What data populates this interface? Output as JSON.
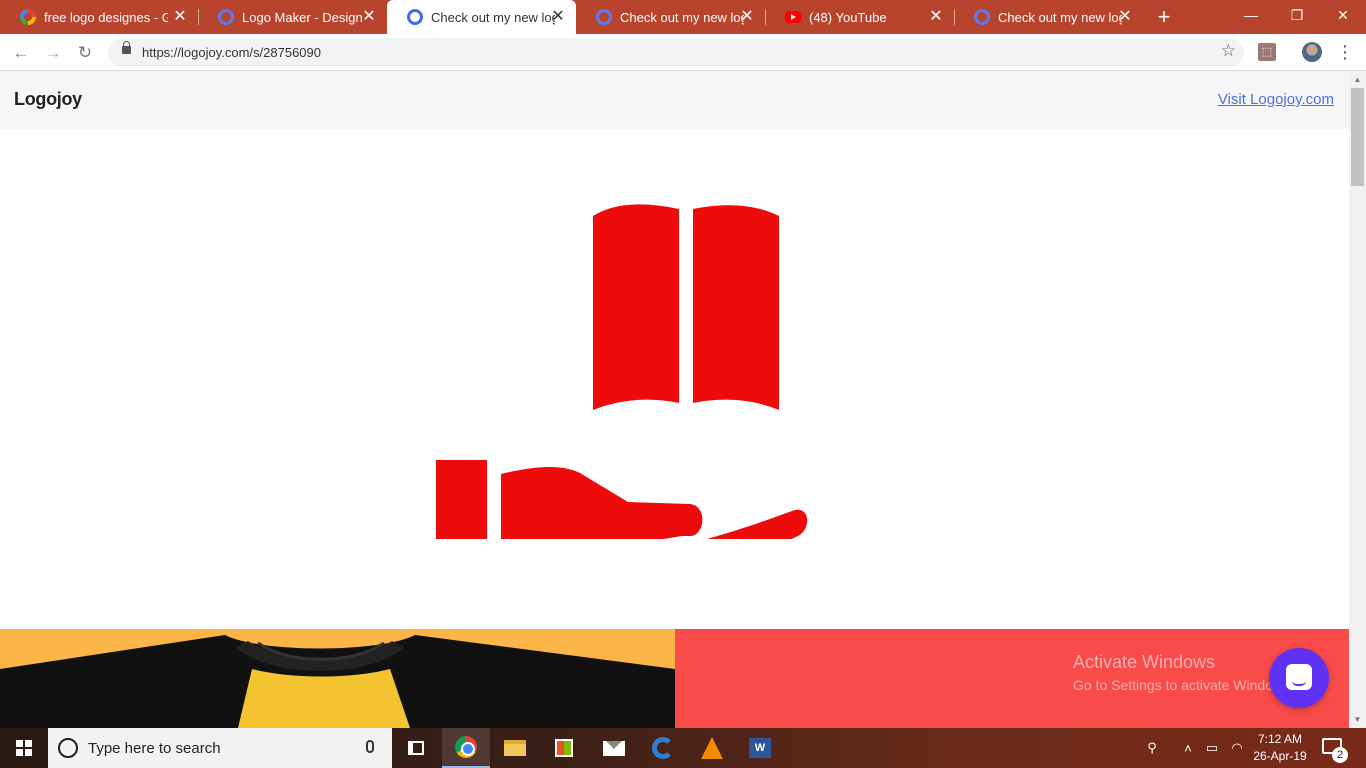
{
  "browser": {
    "tabs": [
      {
        "title": "free logo designes - Go",
        "icon": "google-icon",
        "active": false
      },
      {
        "title": "Logo Maker - Design a",
        "icon": "chrome-icon",
        "active": false
      },
      {
        "title": "Check out my new logo",
        "icon": "chrome-icon",
        "active": true
      },
      {
        "title": "Check out my new logo",
        "icon": "chrome-icon",
        "active": false
      },
      {
        "title": "(48) YouTube",
        "icon": "youtube-icon",
        "active": false
      },
      {
        "title": "Check out my new logo",
        "icon": "chrome-icon",
        "active": false
      }
    ],
    "new_tab": "+",
    "address": {
      "url": "https://logojoy.com/s/28756090"
    },
    "window": {
      "minimize": "—",
      "restore": "❐",
      "close": "✕"
    }
  },
  "site": {
    "brand": "Logojoy",
    "visit_link": "Visit Logojoy.com"
  },
  "logo": {
    "color": "#ed0b0b",
    "icon": "book-in-hand-icon"
  },
  "mockups": {
    "left_color": "#fcb549",
    "right_color": "#f94b49"
  },
  "watermark": {
    "title": "Activate Windows",
    "subtitle": "Go to Settings to activate Windows."
  },
  "taskbar": {
    "search_placeholder": "Type here to search",
    "clock_time": "7:12 AM",
    "clock_date": "26-Apr-19",
    "notification_count": "2",
    "pinned": [
      "task-view",
      "chrome",
      "file-explorer",
      "store",
      "mail",
      "edge",
      "vlc",
      "word"
    ]
  },
  "colors": {
    "tabstrip": "#b8442d",
    "accent_link": "#4f6fe0",
    "chat": "#6132f5"
  }
}
